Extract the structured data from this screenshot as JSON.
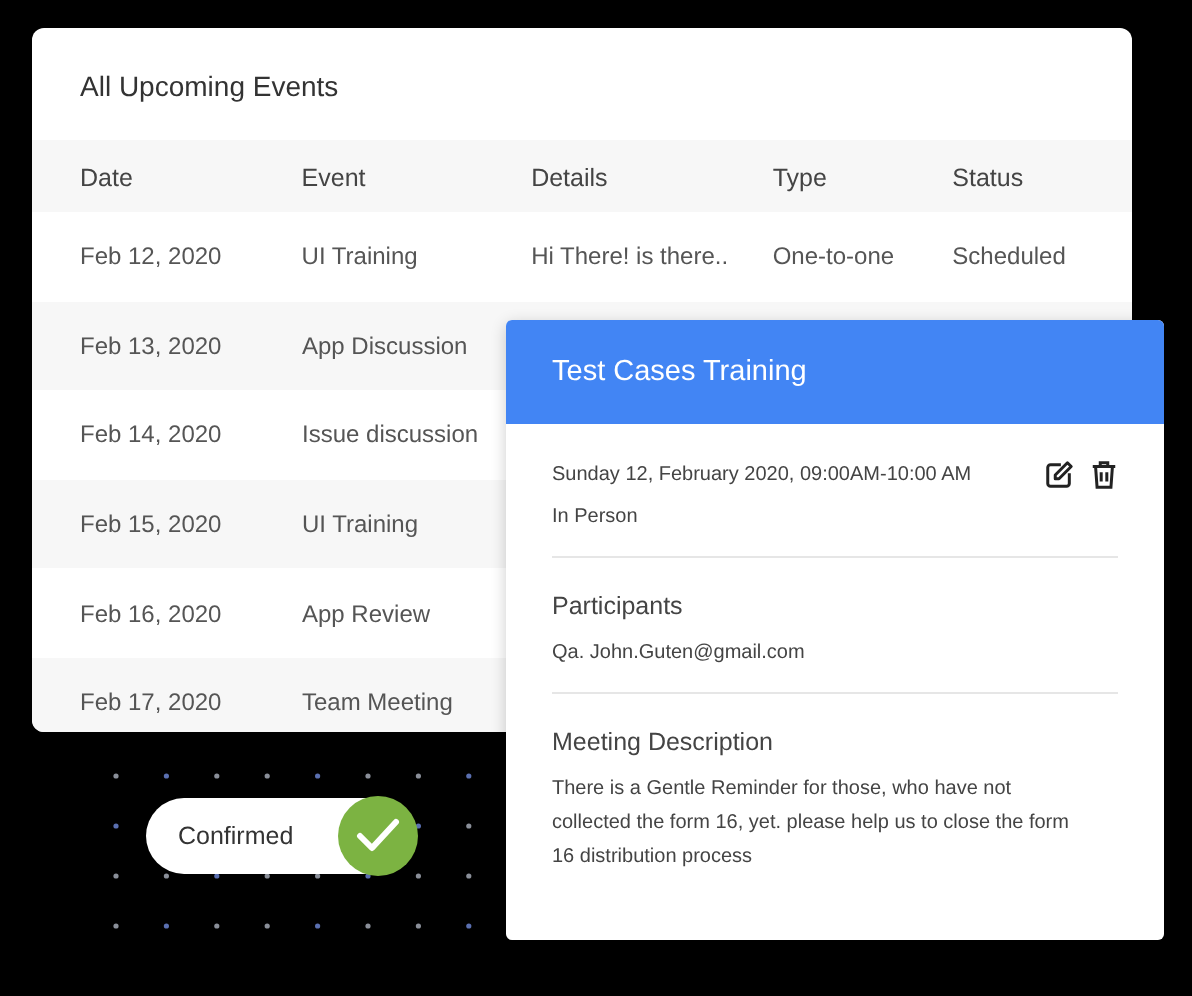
{
  "events_table": {
    "title": "All Upcoming Events",
    "columns": [
      "Date",
      "Event",
      "Details",
      "Type",
      "Status"
    ],
    "rows": [
      {
        "cells": [
          "Feb 12, 2020",
          "UI Training",
          "Hi There! is there..",
          "One-to-one",
          "Scheduled"
        ]
      },
      {
        "cells": [
          "Feb 13, 2020",
          "App Discussion"
        ]
      },
      {
        "cells": [
          "Feb 14, 2020",
          "Issue discussion"
        ]
      },
      {
        "cells": [
          "Feb 15, 2020",
          "UI Training"
        ]
      },
      {
        "cells": [
          "Feb 16, 2020",
          "App Review"
        ]
      },
      {
        "cells": [
          "Feb 17, 2020",
          "Team Meeting"
        ]
      }
    ]
  },
  "event_popup": {
    "title": "Test Cases Training",
    "datetime": "Sunday 12, February 2020, 09:00AM-10:00 AM",
    "mode": "In Person",
    "participants_heading": "Participants",
    "participants": [
      "Qa. John.Guten@gmail.com"
    ],
    "description_heading": "Meeting Description",
    "description": "There is a Gentle Reminder for those, who have not collected the form 16, yet. please help us to close the form 16 distribution process"
  },
  "status_toggle": {
    "label": "Confirmed",
    "checked": true
  }
}
